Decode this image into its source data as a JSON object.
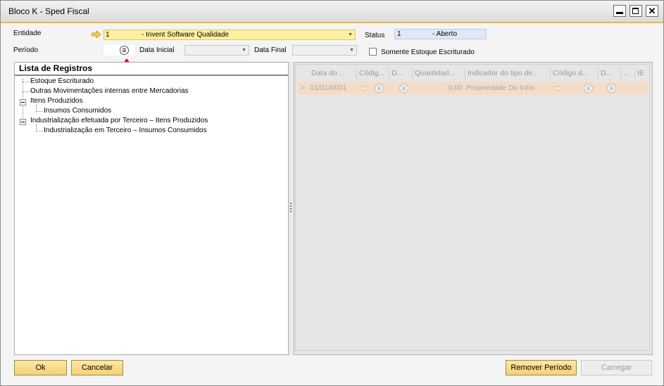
{
  "window": {
    "title": "Bloco K - Sped Fiscal",
    "controls": [
      "minimize-icon",
      "maximize-icon",
      "close-icon"
    ],
    "close_glyph": "✕"
  },
  "form": {
    "entidade": {
      "label": "Entidade",
      "code": "1",
      "name": "- Invent Software Qualidade"
    },
    "status": {
      "label": "Status",
      "code": "1",
      "name": "- Aberto"
    },
    "periodo": {
      "label": "Período",
      "value": ""
    },
    "data_inicial": {
      "label": "Data Inicial",
      "value": ""
    },
    "data_final": {
      "label": "Data Final",
      "value": ""
    },
    "somente_estoque": {
      "label": "Somente Estoque Escriturado",
      "checked": false
    }
  },
  "tree": {
    "title": "Lista de Registros",
    "items": [
      {
        "label": "Estoque Escriturado"
      },
      {
        "label": "Outras Movimentações internas entre Mercadorias"
      },
      {
        "label": "Itens Produzidos"
      },
      {
        "label": "Insumos Consumidos"
      },
      {
        "label": "Industrialização efetuada por Terceiro – Itens Produzidos"
      },
      {
        "label": "Industrialização em Terceiro – Insumos Consumidos"
      }
    ]
  },
  "grid": {
    "columns": [
      "Data do ...",
      "Códig...",
      "D...",
      "Quantidad...",
      "Indicador do tipo de...",
      "Código d...",
      "D...",
      "...",
      "IE"
    ],
    "row": {
      "marker": ">",
      "date": "01/01/0001",
      "quantity": "0,00",
      "indicator": "Propriedade Do Infor..."
    }
  },
  "buttons": {
    "ok": "Ok",
    "cancel": "Cancelar",
    "remover": "Remover Período",
    "carregar": "Carregar"
  },
  "colors": {
    "accent": "#f0b73c",
    "entity_field": "#fdf0a0",
    "status_field": "#dfe9f6",
    "grid_row": "#f5dcc8",
    "annotation_arrow": "#e8000a"
  }
}
